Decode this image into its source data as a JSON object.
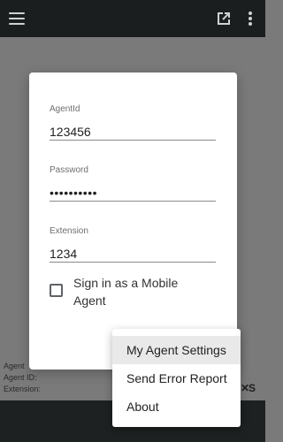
{
  "topbar": {
    "menu_icon": "hamburger-menu-icon",
    "popout_icon": "open-in-new-icon",
    "more_icon": "more-vert-icon"
  },
  "login_dialog": {
    "agent_id": {
      "label": "AgentId",
      "value": "123456"
    },
    "password": {
      "label": "Password",
      "value": "••••••••••"
    },
    "extension": {
      "label": "Extension",
      "value": "1234"
    },
    "mobile_agent": {
      "label": "Sign in as a Mobile Agent",
      "checked": false
    }
  },
  "background_info": {
    "line1": "Agent",
    "line2": "Agent ID:",
    "line3": "Extension:"
  },
  "overflow_menu": {
    "items": [
      {
        "label": "My Agent Settings",
        "active": true
      },
      {
        "label": "Send Error Report",
        "active": false
      },
      {
        "label": "About",
        "active": false
      }
    ]
  },
  "colors": {
    "topbar": "#1b1e1e",
    "backdrop": "#7a7a7a",
    "dialog": "#ffffff",
    "menu_highlight": "#e9e9e9"
  }
}
